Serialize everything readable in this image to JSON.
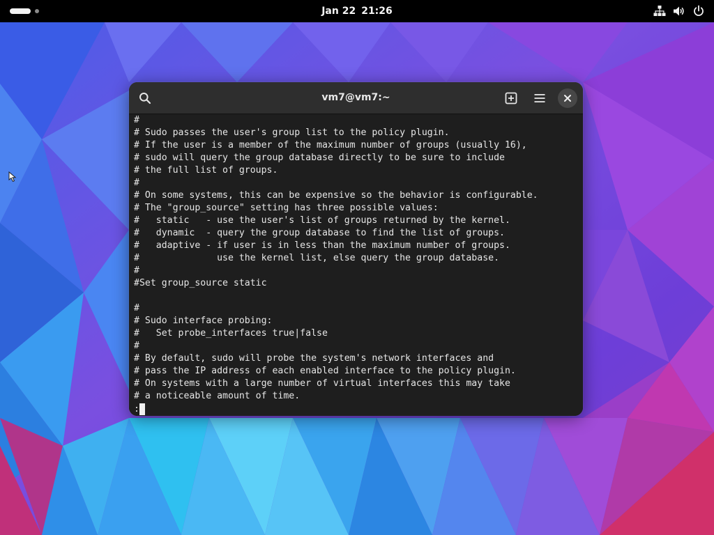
{
  "topbar": {
    "date": "Jan 22",
    "time": "21:26",
    "icons": [
      "activities-indicator",
      "network-wired-icon",
      "volume-icon",
      "power-icon"
    ]
  },
  "terminal": {
    "title": "vm7@vm7:~",
    "header_icons": [
      "search-icon",
      "new-tab-icon",
      "hamburger-menu-icon",
      "close-icon"
    ],
    "lines": [
      "#",
      "# Sudo passes the user's group list to the policy plugin.",
      "# If the user is a member of the maximum number of groups (usually 16),",
      "# sudo will query the group database directly to be sure to include",
      "# the full list of groups.",
      "#",
      "# On some systems, this can be expensive so the behavior is configurable.",
      "# The \"group_source\" setting has three possible values:",
      "#   static   - use the user's list of groups returned by the kernel.",
      "#   dynamic  - query the group database to find the list of groups.",
      "#   adaptive - if user is in less than the maximum number of groups.",
      "#              use the kernel list, else query the group database.",
      "#",
      "#Set group_source static",
      "",
      "#",
      "# Sudo interface probing:",
      "#   Set probe_interfaces true|false",
      "#",
      "# By default, sudo will probe the system's network interfaces and",
      "# pass the IP address of each enabled interface to the policy plugin.",
      "# On systems with a large number of virtual interfaces this may take",
      "# a noticeable amount of time."
    ],
    "prompt": ":"
  },
  "colors": {
    "topbar_bg": "#000000",
    "terminal_bg": "#1e1e1e",
    "headerbar_bg": "#2e2e2e",
    "text": "#e6e6e6"
  }
}
